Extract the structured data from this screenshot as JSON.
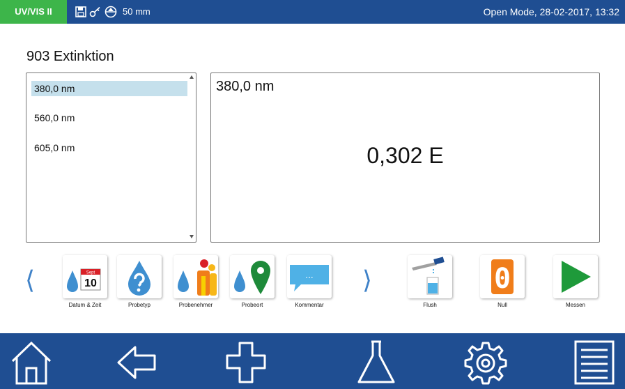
{
  "status": {
    "mode": "UV/VIS II",
    "cuvette": "50 mm",
    "right": "Open Mode, 28-02-2017, 13:32",
    "icons": [
      "save-icon",
      "key-icon",
      "cuvette-icon"
    ]
  },
  "page": {
    "title": "903 Extinktion"
  },
  "wavelengths": {
    "items": [
      {
        "label": "380,0 nm",
        "selected": true
      },
      {
        "label": "560,0 nm",
        "selected": false
      },
      {
        "label": "605,0 nm",
        "selected": false
      }
    ]
  },
  "result": {
    "wavelength": "380,0 nm",
    "value": "0,302 E"
  },
  "toolbar": {
    "prev": "⟨",
    "next": "⟩",
    "calendar_month": "Sept",
    "calendar_day": "10",
    "datum_label": "Datum & Zeit",
    "probetyp_label": "Probetyp",
    "probenehmer_label": "Probenehmer",
    "probeort_label": "Probeort",
    "kommentar_label": "Kommentar",
    "kommentar_dots": "...",
    "flush_label": "Flush",
    "null_label": "Null",
    "null_glyph": "0",
    "messen_label": "Messen"
  },
  "colors": {
    "header_blue": "#1f4e92",
    "mode_green": "#3db54a",
    "selection": "#c5e0ec",
    "drop_blue": "#3f8fd0",
    "null_orange": "#f07d1a",
    "messen_green": "#1e9a3a"
  },
  "bottom_nav": [
    "home-icon",
    "back-icon",
    "add-icon",
    "flask-icon",
    "settings-icon",
    "menu-icon"
  ]
}
